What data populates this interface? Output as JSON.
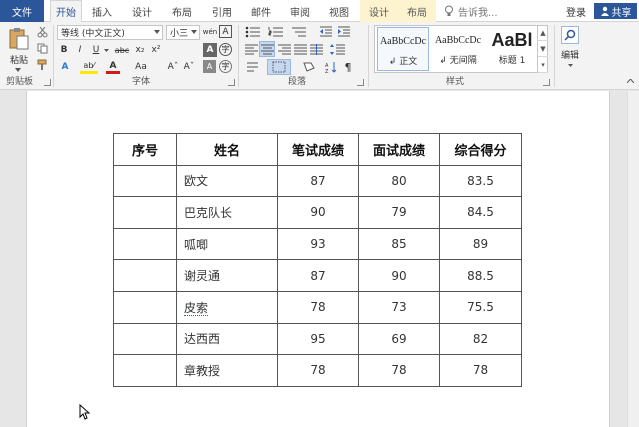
{
  "tabs": {
    "file": "文件",
    "items": [
      "开始",
      "插入",
      "设计",
      "布局",
      "引用",
      "邮件",
      "审阅",
      "视图"
    ],
    "contextual": [
      "设计",
      "布局"
    ],
    "tell_me": "告诉我...",
    "login": "登录",
    "share": "共享"
  },
  "ribbon": {
    "clipboard": {
      "paste": "粘贴",
      "label": "剪贴板"
    },
    "font": {
      "family": "等线 (中文正文)",
      "size": "小三",
      "label": "字体",
      "buttons": [
        "B",
        "I",
        "U",
        "abc",
        "x₂",
        "x²"
      ],
      "phonetic": "wén",
      "char_border": "A",
      "text_effects": "A",
      "highlight": "ab⁄",
      "font_color": "A",
      "change_case": "Aa",
      "grow": "Aˆ",
      "shrink": "Aˇ",
      "clear": "A",
      "enclose": "字"
    },
    "paragraph": {
      "label": "段落"
    },
    "styles": {
      "label": "样式",
      "items": [
        {
          "sample": "AaBbCcDc",
          "name": "正文"
        },
        {
          "sample": "AaBbCcDc",
          "name": "无间隔"
        },
        {
          "sample": "AaBl",
          "name": "标题 1"
        }
      ]
    },
    "editing": {
      "label": "编辑"
    }
  },
  "table": {
    "headers": [
      "序号",
      "姓名",
      "笔试成绩",
      "面试成绩",
      "综合得分"
    ],
    "rows": [
      [
        "",
        "欧文",
        "87",
        "80",
        "83.5"
      ],
      [
        "",
        "巴克队长",
        "90",
        "79",
        "84.5"
      ],
      [
        "",
        "呱唧",
        "93",
        "85",
        "89"
      ],
      [
        "",
        "谢灵通",
        "87",
        "90",
        "88.5"
      ],
      [
        "",
        "皮索",
        "78",
        "73",
        "75.5"
      ],
      [
        "",
        "达西西",
        "95",
        "69",
        "82"
      ],
      [
        "",
        "章教授",
        "78",
        "78",
        "78"
      ]
    ]
  },
  "colors": {
    "accent": "#2b579a",
    "ribbon_bg": "#f3f3f3",
    "contextual_tab": "#fdf3cf"
  }
}
